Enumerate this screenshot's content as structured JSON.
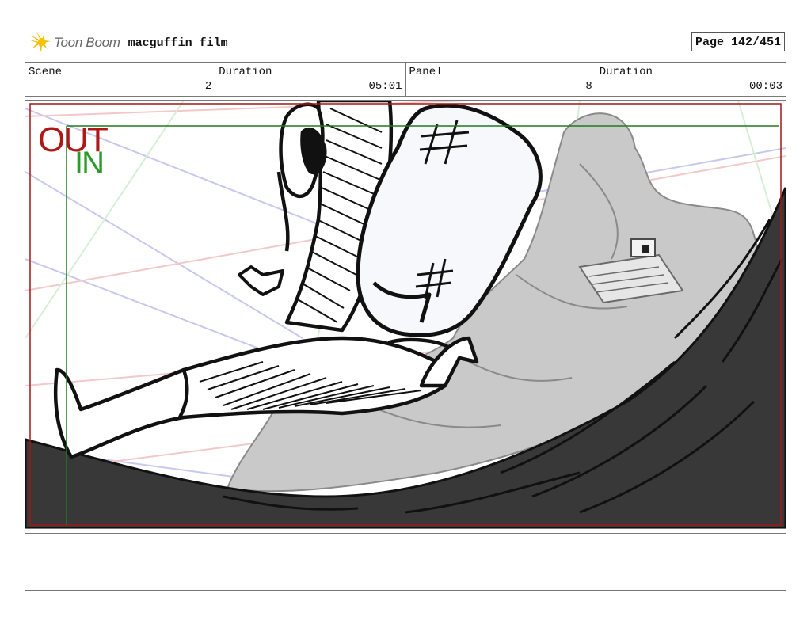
{
  "header": {
    "logo_text": "Toon Boom",
    "project_title": "macguffin film",
    "page_indicator": "Page 142/451"
  },
  "info": {
    "scene_label": "Scene",
    "scene_value": "2",
    "scene_duration_label": "Duration",
    "scene_duration_value": "05:01",
    "panel_label": "Panel",
    "panel_value": "8",
    "panel_duration_label": "Duration",
    "panel_duration_value": "00:03"
  },
  "panel": {
    "out_label": "OUT",
    "in_label": "IN",
    "out_color": "#b01818",
    "in_color": "#2a9a2a"
  },
  "caption": {
    "text": ""
  },
  "colors": {
    "border": "#777777",
    "ground": "#383838",
    "rock": "#c8c8c8"
  }
}
